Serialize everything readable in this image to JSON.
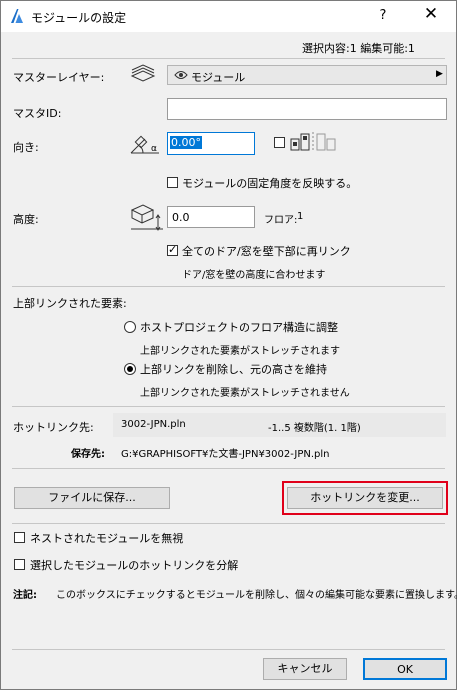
{
  "window": {
    "title": "モジュールの設定",
    "help": "?",
    "close": "✕"
  },
  "status": "選択内容:1 編集可能:1",
  "master_layer": {
    "label": "マスターレイヤー:",
    "value": "モジュール",
    "arrow": "▶"
  },
  "master_id": {
    "label": "マスタID:",
    "value": ""
  },
  "orientation": {
    "label": "向き:",
    "value": "0.00°",
    "mirror_checked": false
  },
  "fixed_angle": {
    "label": "モジュールの固定角度を反映する。",
    "checked": false
  },
  "height": {
    "label": "高度:",
    "value": "0.0",
    "floor_label": "フロア:",
    "floor_value": "1"
  },
  "reconnect": {
    "label": "全てのドア/窓を壁下部に再リンク",
    "checked": true,
    "note": "ドア/窓を壁の高度に合わせます"
  },
  "top_linked": {
    "label": "上部リンクされた要素:",
    "options": [
      {
        "label": "ホストプロジェクトのフロア構造に調整",
        "note": "上部リンクされた要素がストレッチされます",
        "selected": false
      },
      {
        "label": "上部リンクを削除し、元の高さを維持",
        "note": "上部リンクされた要素がストレッチされません",
        "selected": true
      }
    ]
  },
  "hotlink": {
    "source_label": "ホットリンク先:",
    "source_file": "3002-JPN.pln",
    "source_story": "-1..5 複数階(1. 1階)",
    "saved_label": "保存先:",
    "saved_path": "G:¥GRAPHISOFT¥た文書-JPN¥3002-JPN.pln"
  },
  "buttons": {
    "save_file": "ファイルに保存...",
    "change_hotlink": "ホットリンクを変更...",
    "cancel": "キャンセル",
    "ok": "OK"
  },
  "ignore_nested": {
    "label": "ネストされたモジュールを無視",
    "checked": false
  },
  "break_link": {
    "label": "選択したモジュールのホットリンクを分解",
    "checked": false
  },
  "note": {
    "label": "注記:",
    "text": "このボックスにチェックするとモジュールを削除し、個々の編集可能な要素に置換します。"
  },
  "colors": {
    "highlight": "#e0001a",
    "selection": "#0078d7",
    "ok_border": "#0078d7"
  }
}
